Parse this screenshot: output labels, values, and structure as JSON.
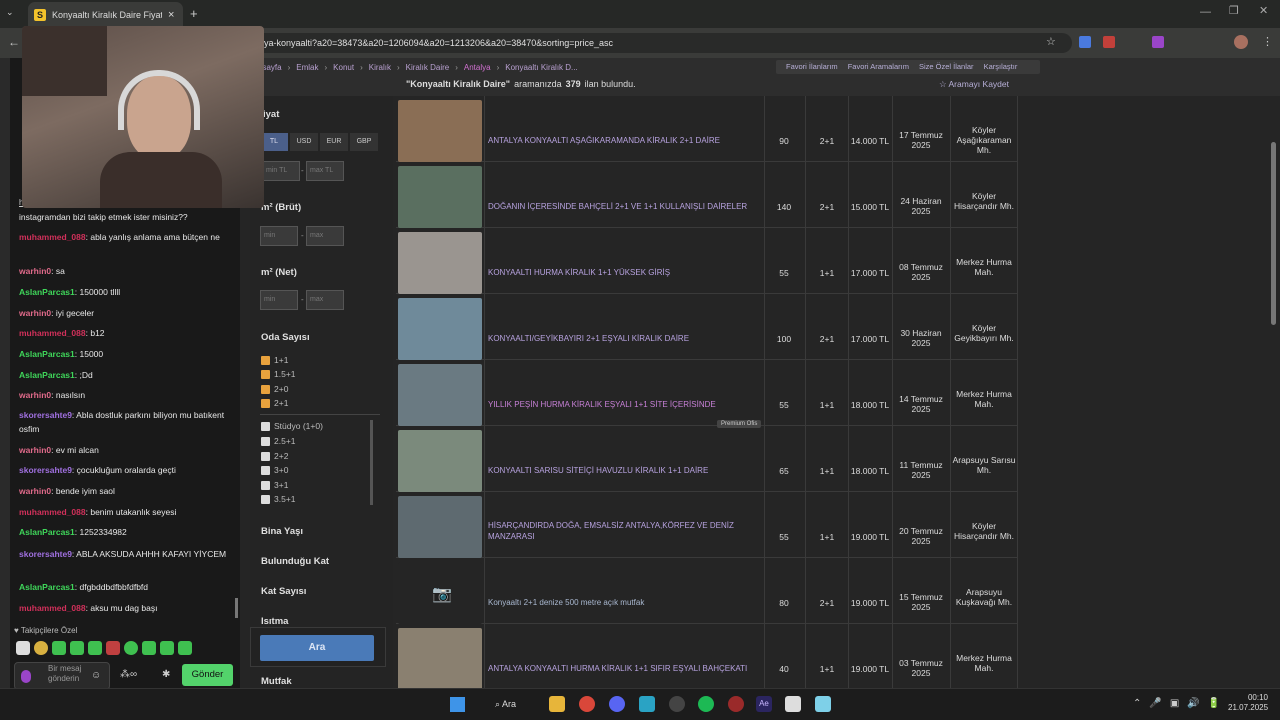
{
  "browser": {
    "tab_title": "Konyaaltı Kiralık Daire Fiyatları",
    "url": "lya-konyaalti?a20=38473&a20=1206094&a20=1213206&a20=38470&sorting=price_asc"
  },
  "site": {
    "breadcrumbs": [
      "asayfa",
      "Emlak",
      "Konut",
      "Kiralık",
      "Kiralık Daire",
      "Antalya",
      "Konyaaltı Kiralık D..."
    ],
    "top_links": [
      "Favori İlanlarım",
      "Favori Aramalarım",
      "Size Özel İlanlar",
      "Karşılaştır"
    ],
    "result_query": "\"Konyaaltı Kiralık Daire\"",
    "result_text": "aramanızda",
    "result_count": "379",
    "result_suffix": "ilan bulundu.",
    "save_search": "Aramayı Kaydet"
  },
  "filters": {
    "price_title": "iyat",
    "currencies": [
      "TL",
      "USD",
      "EUR",
      "GBP"
    ],
    "min_tl": "min TL",
    "max_tl": "max TL",
    "brut_title": "m² (Brüt)",
    "net_title": "m² (Net)",
    "min": "min",
    "max": "max",
    "rooms_title": "Oda Sayısı",
    "rooms_checked": [
      "1+1",
      "1.5+1",
      "2+0",
      "2+1"
    ],
    "rooms_unchecked": [
      "Stüdyo (1+0)",
      "2.5+1",
      "2+2",
      "3+0",
      "3+1",
      "3.5+1"
    ],
    "more": [
      "Bina Yaşı",
      "Bulunduğu Kat",
      "Kat Sayısı",
      "Isıtma"
    ],
    "search_button": "Ara",
    "mutfak": "Mutfak"
  },
  "listings": [
    {
      "title": "ANTALYA KONYAALTI AŞAĞIKARAMANDA KİRALIK 2+1 DAİRE",
      "m2": "90",
      "rooms": "2+1",
      "price": "14.000 TL",
      "date": "17 Temmuz 2025",
      "loc": "Köyler Aşağıkaraman Mh."
    },
    {
      "title": "DOĞANIN İÇERESİNDE BAHÇELİ 2+1 VE 1+1 KULLANIŞLI DAİRELER",
      "m2": "140",
      "rooms": "2+1",
      "price": "15.000 TL",
      "date": "24 Haziran 2025",
      "loc": "Köyler Hisarçandır Mh."
    },
    {
      "title": "KONYAALTI HURMA KİRALIK 1+1 YÜKSEK GİRİŞ",
      "m2": "55",
      "rooms": "1+1",
      "price": "17.000 TL",
      "date": "08 Temmuz 2025",
      "loc": "Merkez Hurma Mah."
    },
    {
      "title": "KONYAALTI/GEYİKBAYIRI 2+1 EŞYALI KİRALIK DAİRE",
      "m2": "100",
      "rooms": "2+1",
      "price": "17.000 TL",
      "date": "30 Haziran 2025",
      "loc": "Köyler Geyikbayırı Mh."
    },
    {
      "title": "YILLIK PEŞİN HURMA KİRALIK EŞYALI 1+1 SİTE İÇERİSİNDE",
      "m2": "55",
      "rooms": "1+1",
      "price": "18.000 TL",
      "date": "14 Temmuz 2025",
      "loc": "Merkez Hurma Mah.",
      "badge": "Premium Ofis"
    },
    {
      "title": "KONYAALTI SARISU SİTEİÇİ HAVUZLU KİRALIK 1+1 DAİRE",
      "m2": "65",
      "rooms": "1+1",
      "price": "18.000 TL",
      "date": "11 Temmuz 2025",
      "loc": "Arapsuyu Sarısu Mh."
    },
    {
      "title": "HİSARÇANDIRDA DOĞA, EMSALSİZ ANTALYA,KÖRFEZ VE DENİZ MANZARASI",
      "m2": "55",
      "rooms": "1+1",
      "price": "19.000 TL",
      "date": "20 Temmuz 2025",
      "loc": "Köyler Hisarçandır Mh."
    },
    {
      "title": "Konyaaltı 2+1 denize 500 metre açık mutfak",
      "m2": "80",
      "rooms": "2+1",
      "price": "19.000 TL",
      "date": "15 Temmuz 2025",
      "loc": "Arapsuyu Kuşkavağı Mh."
    },
    {
      "title": "ANTALYA KONYAALTI HURMA KİRALIK 1+1 SIFIR EŞYALI BAHÇEKATI",
      "m2": "40",
      "rooms": "1+1",
      "price": "19.000 TL",
      "date": "03 Temmuz 2025",
      "loc": "Merkez Hurma Mah."
    }
  ],
  "chat": {
    "messages": [
      {
        "user": "",
        "text": "instagramdan bizi takip etmek ister misiniz??",
        "color": "#e8e8e8"
      },
      {
        "user": "muhammed_088",
        "text": ": abla yanlış anlama ama bütçen ne",
        "color": "#d0305a"
      },
      {
        "user": "warhin0",
        "text": ": sa",
        "color": "#e06a8a"
      },
      {
        "user": "AslanParcas1",
        "text": ": 150000 tllll",
        "color": "#3fd65a"
      },
      {
        "user": "warhin0",
        "text": ": iyi geceler",
        "color": "#e06a8a"
      },
      {
        "user": "muhammed_088",
        "text": ": b12",
        "color": "#d0305a"
      },
      {
        "user": "AslanParcas1",
        "text": ": 15000",
        "color": "#3fd65a"
      },
      {
        "user": "AslanParcas1",
        "text": ": ;Dd",
        "color": "#3fd65a"
      },
      {
        "user": "warhin0",
        "text": ": nasılsın",
        "color": "#e06a8a"
      },
      {
        "user": "skorersahte9",
        "text": ": Abla dostluk parkını biliyon mu batıkent osfim",
        "color": "#a070e0"
      },
      {
        "user": "warhin0",
        "text": ": ev mi alcan",
        "color": "#e06a8a"
      },
      {
        "user": "skorersahte9",
        "text": ": çocukluğum oralarda geçti",
        "color": "#a070e0"
      },
      {
        "user": "warhin0",
        "text": ": bende iyim saol",
        "color": "#e06a8a"
      },
      {
        "user": "muhammed_088",
        "text": ": benim utakanlık seyesi",
        "color": "#d0305a"
      },
      {
        "user": "AslanParcas1",
        "text": ": 1252334982",
        "color": "#3fd65a"
      },
      {
        "user": "skorersahte9",
        "text": ": ABLA AKSUDA AHHH KAFAYI YİYCEM",
        "color": "#a070e0"
      },
      {
        "user": "AslanParcas1",
        "text": ": dfgbddbdfbbfdfbfd",
        "color": "#3fd65a"
      },
      {
        "user": "muhammed_088",
        "text": ": aksu mu dag başı",
        "color": "#d0305a"
      }
    ],
    "followers_label": "Takipçilere Özel",
    "placeholder": "Bir mesaj gönderin",
    "send": "Gönder",
    "link": "http"
  },
  "taskbar": {
    "search": "Ara",
    "time": "00:10",
    "date": "21.07.2025"
  }
}
